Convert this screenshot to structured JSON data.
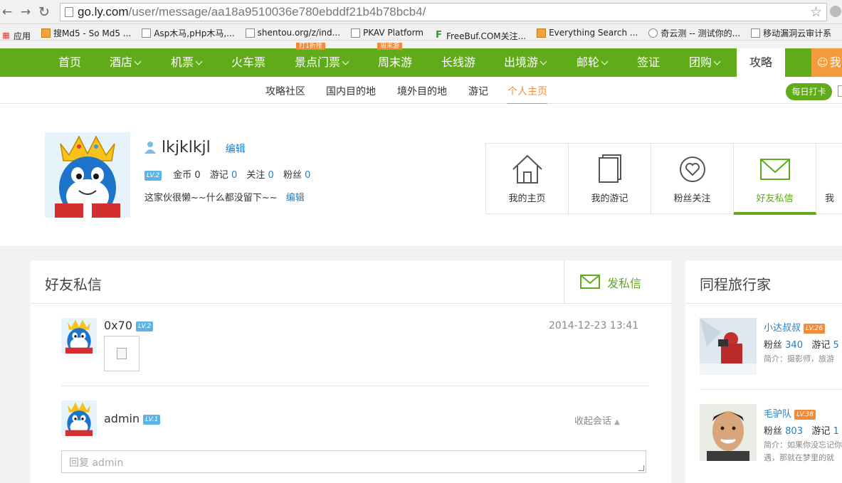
{
  "browser": {
    "url_host": "go.ly.com",
    "url_path": "/user/message/aa18a9510036e780ebddf21b4b78bcb4/",
    "bookmarks": [
      {
        "label": "应用",
        "icon": "apps-grid-icon"
      },
      {
        "label": "搜Md5 - So Md5 ...",
        "icon": "md5-site-icon"
      },
      {
        "label": "Asp木马,pHp木马,...",
        "icon": "page-icon"
      },
      {
        "label": "shentou.org/z/ind...",
        "icon": "page-icon"
      },
      {
        "label": "PKAV Platform",
        "icon": "page-icon"
      },
      {
        "label": "FreeBuf.COM关注...",
        "icon": "freebuf-icon"
      },
      {
        "label": "Everything Search ...",
        "icon": "search-site-icon"
      },
      {
        "label": "奇云测 -- 测试你的...",
        "icon": "clock-icon"
      },
      {
        "label": "移动漏洞云审计系",
        "icon": "page-icon"
      }
    ]
  },
  "topnav": {
    "items": [
      {
        "label": "首页",
        "dropdown": false
      },
      {
        "label": "酒店",
        "dropdown": true
      },
      {
        "label": "机票",
        "dropdown": true
      },
      {
        "label": "火车票",
        "dropdown": false
      },
      {
        "label": "景点门票",
        "dropdown": true
      },
      {
        "label": "周末游",
        "dropdown": false
      },
      {
        "label": "长线游",
        "dropdown": false
      },
      {
        "label": "出境游",
        "dropdown": true
      },
      {
        "label": "邮轮",
        "dropdown": true
      },
      {
        "label": "签证",
        "dropdown": false
      },
      {
        "label": "团购",
        "dropdown": true
      },
      {
        "label": "攻略",
        "dropdown": false
      }
    ],
    "tag_1": "打1折抢",
    "tag_2": "周末游",
    "login_label": "我"
  },
  "subnav": {
    "items": [
      "攻略社区",
      "国内目的地",
      "境外目的地",
      "游记",
      "个人主页"
    ],
    "active": "个人主页",
    "checkin_label": "每日打卡"
  },
  "profile": {
    "username": "lkjklkjl",
    "edit_label": "编辑",
    "level": "LV.2",
    "stats": {
      "coins_label": "金币",
      "coins": "0",
      "travelogues_label": "游记",
      "travelogues": "0",
      "following_label": "关注",
      "following": "0",
      "fans_label": "粉丝",
      "fans": "0"
    },
    "bio": "这家伙很懒~~什么都没留下~~",
    "bio_edit_label": "编辑"
  },
  "profile_tabs": [
    {
      "label": "我的主页",
      "icon": "home-icon"
    },
    {
      "label": "我的游记",
      "icon": "documents-icon"
    },
    {
      "label": "粉丝关注",
      "icon": "heart-icon"
    },
    {
      "label": "好友私信",
      "icon": "envelope-icon",
      "active": true
    },
    {
      "label": "我",
      "icon": "more-icon"
    }
  ],
  "messages_panel": {
    "title": "好友私信",
    "send_label": "发私信",
    "messages": [
      {
        "name": "0x70",
        "level": "LV.2",
        "time": "2014-12-23 13:41"
      },
      {
        "name": "admin",
        "level": "LV.1",
        "collapse_label": "收起会话"
      }
    ],
    "reply_placeholder": "回复 admin"
  },
  "travelers_panel": {
    "title": "同程旅行家",
    "travelers": [
      {
        "name": "小达叔叔",
        "level": "LV.26",
        "fans_label": "粉丝",
        "fans": "340",
        "logs_label": "游记",
        "logs": "5",
        "bio": "简介：摄影师，旅游"
      },
      {
        "name": "毛驴队",
        "level": "LV.38",
        "fans_label": "粉丝",
        "fans": "803",
        "logs_label": "游记",
        "logs": "1",
        "bio": "简介：如果你没忘记你遇，那就在梦里的就"
      }
    ]
  },
  "colors": {
    "brand_green": "#5fab1a",
    "accent_orange": "#f18b39",
    "link_blue": "#1f7fc7"
  }
}
